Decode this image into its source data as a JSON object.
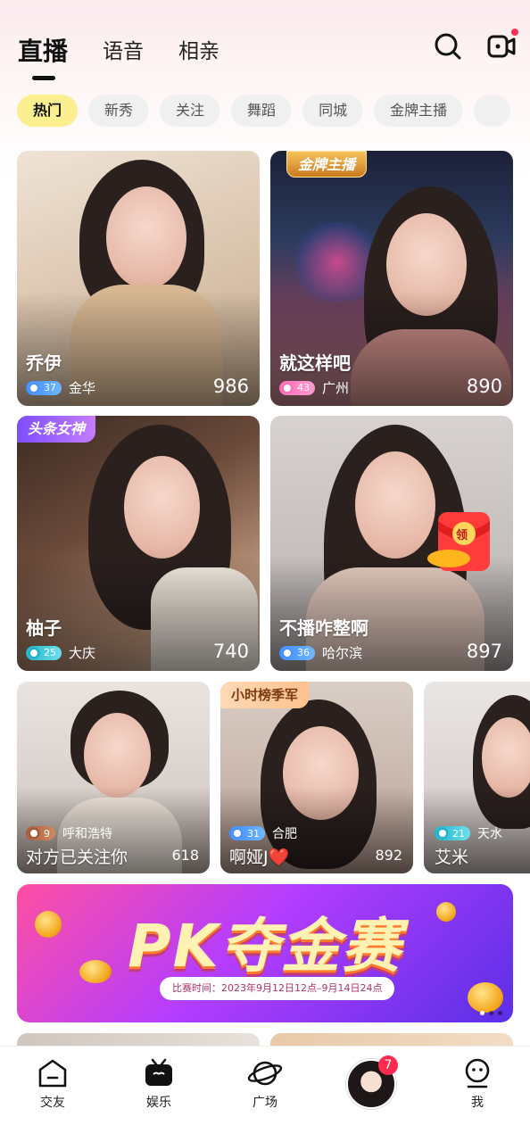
{
  "top_tabs": [
    {
      "label": "直播",
      "active": true
    },
    {
      "label": "语音",
      "active": false
    },
    {
      "label": "相亲",
      "active": false
    }
  ],
  "header_icons": [
    "search-icon",
    "video-camera-icon"
  ],
  "categories": [
    {
      "label": "热门",
      "active": true
    },
    {
      "label": "新秀"
    },
    {
      "label": "关注"
    },
    {
      "label": "舞蹈"
    },
    {
      "label": "同城"
    },
    {
      "label": "金牌主播"
    }
  ],
  "streams": [
    {
      "name": "乔伊",
      "level": "37",
      "city": "金华",
      "viewers": "986",
      "badge": ""
    },
    {
      "name": "就这样吧",
      "level": "43",
      "city": "广州",
      "viewers": "890",
      "badge": "金牌主播"
    },
    {
      "name": "柚子",
      "level": "25",
      "city": "大庆",
      "viewers": "740",
      "badge": "头条女神"
    },
    {
      "name": "不播咋整啊",
      "level": "36",
      "city": "哈尔滨",
      "viewers": "897",
      "badge": "",
      "envelope_label": "领"
    },
    {
      "name": "对方已关注你",
      "level": "9",
      "city": "呼和浩特",
      "viewers": "618",
      "badge": ""
    },
    {
      "name": "啊娅J❤️",
      "level": "31",
      "city": "合肥",
      "viewers": "892",
      "badge": "小时榜季军"
    },
    {
      "name": "艾米",
      "level": "21",
      "city": "天水",
      "viewers": "",
      "badge": ""
    }
  ],
  "banner": {
    "title": "PK夺金赛",
    "date_text": "比赛时间：2023年9月12日12点–9月14日24点",
    "slides": 3,
    "active_slide": 1
  },
  "bottom_nav": [
    {
      "label": "交友",
      "icon": "friends-icon"
    },
    {
      "label": "娱乐",
      "icon": "tv-icon",
      "active": true
    },
    {
      "label": "广场",
      "icon": "planet-icon"
    },
    {
      "label": "",
      "icon": "avatar",
      "badge": "7"
    },
    {
      "label": "我",
      "icon": "profile-icon"
    }
  ],
  "colors": {
    "chip_active": "#fbef8f",
    "badge_red": "#ff2a4d"
  }
}
